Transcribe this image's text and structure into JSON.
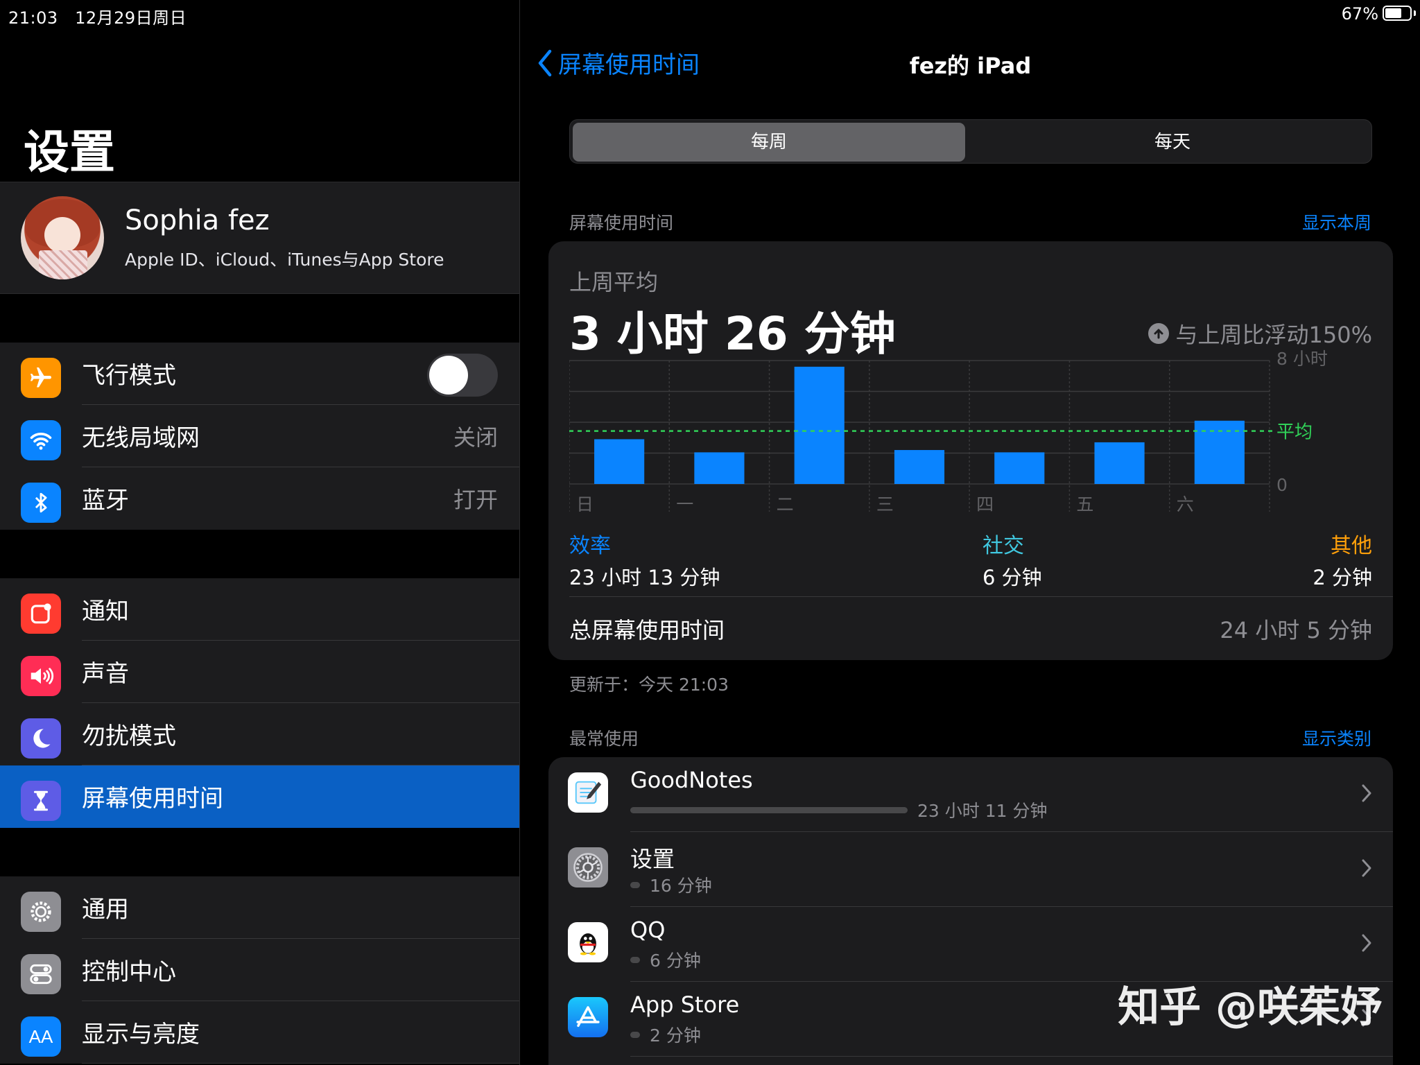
{
  "status": {
    "time": "21:03",
    "date": "12月29日周日",
    "battery": "67%",
    "battery_level": 0.67
  },
  "settings": {
    "title": "设置",
    "profile": {
      "name": "Sophia fez",
      "subtitle": "Apple ID、iCloud、iTunes与App Store"
    },
    "group1": [
      {
        "label": "飞行模式",
        "icon": "airplane-icon",
        "color": "#ff9500",
        "toggle": false
      },
      {
        "label": "无线局域网",
        "icon": "wifi-icon",
        "color": "#0a84ff",
        "value": "关闭"
      },
      {
        "label": "蓝牙",
        "icon": "bluetooth-icon",
        "color": "#0a84ff",
        "value": "打开"
      }
    ],
    "group2": [
      {
        "label": "通知",
        "icon": "notifications-icon",
        "color": "#ff3b30"
      },
      {
        "label": "声音",
        "icon": "sound-icon",
        "color": "#ff2d55"
      },
      {
        "label": "勿扰模式",
        "icon": "moon-icon",
        "color": "#5e5ce6"
      },
      {
        "label": "屏幕使用时间",
        "icon": "hourglass-icon",
        "color": "#5e5ce6",
        "selected": true
      }
    ],
    "group3": [
      {
        "label": "通用",
        "icon": "gear-icon",
        "color": "#8e8e93"
      },
      {
        "label": "控制中心",
        "icon": "switches-icon",
        "color": "#8e8e93"
      },
      {
        "label": "显示与亮度",
        "icon": "text-size-icon",
        "color": "#0a84ff"
      }
    ]
  },
  "detail": {
    "back_label": "屏幕使用时间",
    "title": "fez的 iPad",
    "segments": {
      "weekly": "每周",
      "daily": "每天",
      "selected": "每周"
    },
    "usage_header": "屏幕使用时间",
    "usage_link": "显示本周",
    "avg_label": "上周平均",
    "avg_value": "3 小时 26 分钟",
    "trend": "与上周比浮动150%",
    "categories": [
      {
        "name": "效率",
        "time": "23 小时 13 分钟",
        "color": "#0a84ff"
      },
      {
        "name": "社交",
        "time": "6 分钟",
        "color": "#40c8e0"
      },
      {
        "name": "其他",
        "time": "2 分钟",
        "color": "#ff9f0a"
      }
    ],
    "total_label": "总屏幕使用时间",
    "total_value": "24 小时 5 分钟",
    "updated": "更新于：今天 21:03",
    "most_used_header": "最常使用",
    "most_used_link": "显示类别",
    "apps": [
      {
        "name": "GoodNotes",
        "time": "23 小时 11 分钟",
        "minutes": 1391,
        "icon": "goodnotes-icon"
      },
      {
        "name": "设置",
        "time": "16 分钟",
        "minutes": 16,
        "icon": "settings-app-icon"
      },
      {
        "name": "QQ",
        "time": "6 分钟",
        "minutes": 6,
        "icon": "qq-icon"
      },
      {
        "name": "App Store",
        "time": "2 分钟",
        "minutes": 2,
        "icon": "app-store-icon"
      }
    ]
  },
  "chart_data": {
    "type": "bar",
    "categories": [
      "日",
      "一",
      "二",
      "三",
      "四",
      "五",
      "六"
    ],
    "values": [
      2.9,
      2.05,
      7.6,
      2.2,
      2.05,
      2.7,
      4.1
    ],
    "ylim": [
      0,
      8
    ],
    "y_ticks": [
      "0",
      "8 小时"
    ],
    "average": 3.43,
    "average_label": "平均",
    "bar_color": "#0a84ff",
    "average_color": "#30d158"
  },
  "watermark": "知乎 @咲茱妤"
}
